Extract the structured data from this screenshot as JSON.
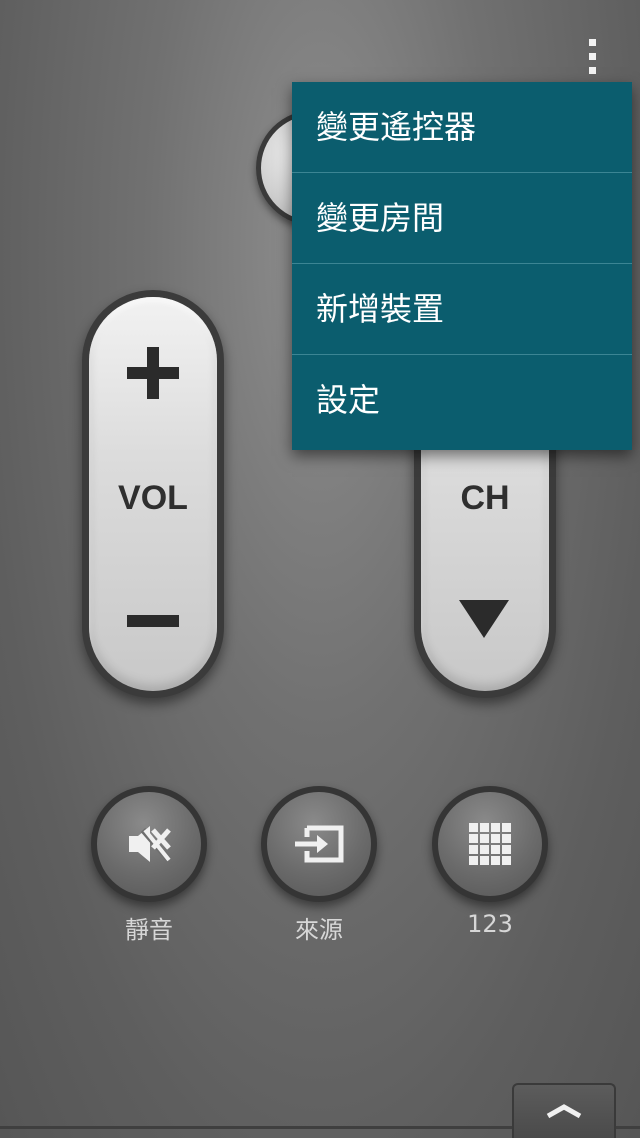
{
  "menu": {
    "items": [
      {
        "label": "變更遙控器"
      },
      {
        "label": "變更房間"
      },
      {
        "label": "新增裝置"
      },
      {
        "label": "設定"
      }
    ]
  },
  "remote": {
    "vol_label": "VOL",
    "ch_label": "CH"
  },
  "buttons": {
    "mute_label": "靜音",
    "source_label": "來源",
    "numpad_label": "123"
  },
  "icons": {
    "overflow": "more-vertical-icon",
    "power": "power-icon",
    "vol_up": "plus-icon",
    "vol_down": "minus-icon",
    "ch_down": "triangle-down-icon",
    "mute": "mute-icon",
    "source": "source-input-icon",
    "numpad": "keypad-grid-icon",
    "drawer": "chevron-up-icon"
  },
  "colors": {
    "menu_background": "#0b5d6e",
    "menu_divider": "#3c8594"
  }
}
